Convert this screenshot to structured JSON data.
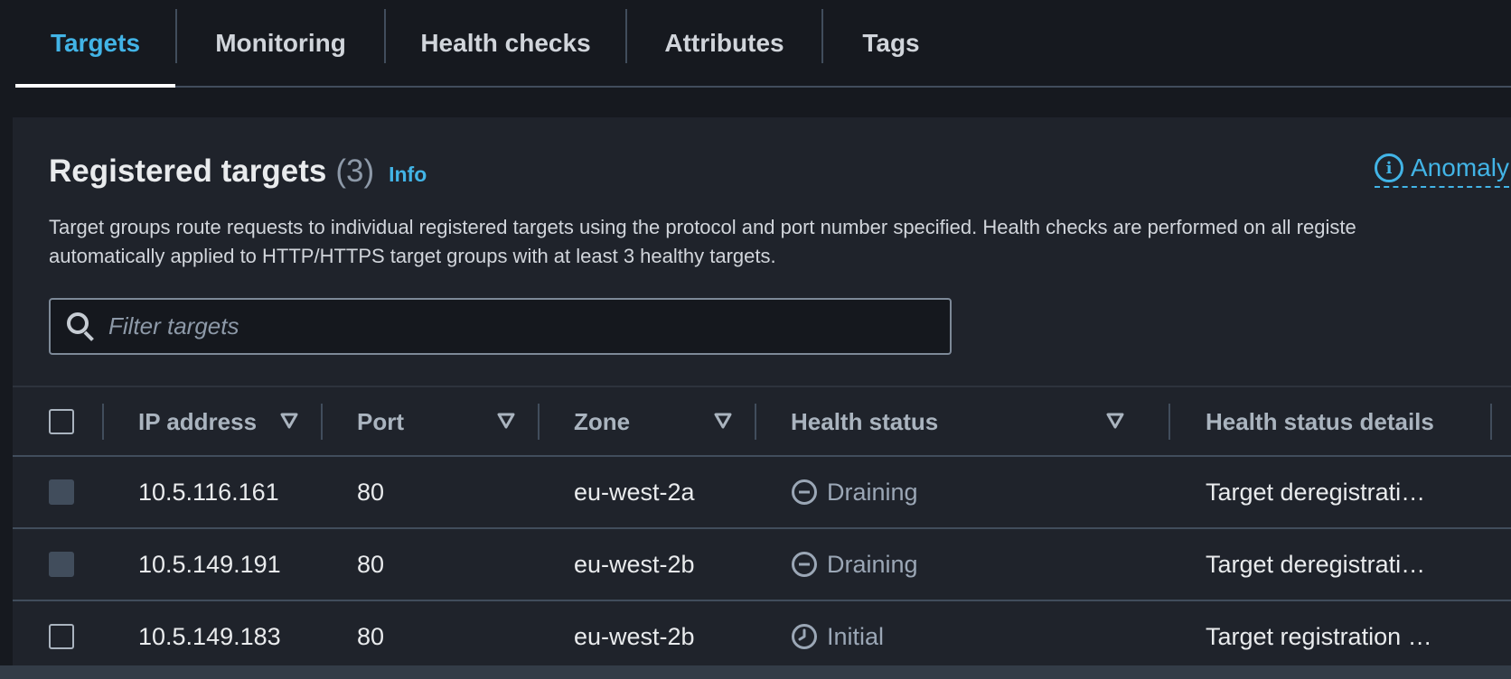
{
  "tabs": [
    {
      "label": "Targets",
      "active": true
    },
    {
      "label": "Monitoring",
      "active": false
    },
    {
      "label": "Health checks",
      "active": false
    },
    {
      "label": "Attributes",
      "active": false
    },
    {
      "label": "Tags",
      "active": false
    }
  ],
  "panel": {
    "title": "Registered targets",
    "count": "(3)",
    "info_link": "Info",
    "anomaly_link": "Anomaly",
    "description_line1": "Target groups route requests to individual registered targets using the protocol and port number specified. Health checks are performed on all registe",
    "description_line2": "automatically applied to HTTP/HTTPS target groups with at least 3 healthy targets.",
    "filter_placeholder": "Filter targets"
  },
  "table": {
    "columns": [
      "IP address",
      "Port",
      "Zone",
      "Health status",
      "Health status details"
    ],
    "rows": [
      {
        "ip": "10.5.116.161",
        "port": "80",
        "zone": "eu-west-2a",
        "status": "Draining",
        "status_icon": "minus-circle-icon",
        "details": "Target deregistrati…",
        "checkbox_disabled": true
      },
      {
        "ip": "10.5.149.191",
        "port": "80",
        "zone": "eu-west-2b",
        "status": "Draining",
        "status_icon": "minus-circle-icon",
        "details": "Target deregistrati…",
        "checkbox_disabled": true
      },
      {
        "ip": "10.5.149.183",
        "port": "80",
        "zone": "eu-west-2b",
        "status": "Initial",
        "status_icon": "clock-icon",
        "details": "Target registration …",
        "checkbox_disabled": false
      }
    ]
  },
  "colors": {
    "accent": "#42b4e6",
    "background": "#16191f",
    "panel": "#1f232b",
    "status_neutral": "#9ba7b6"
  }
}
